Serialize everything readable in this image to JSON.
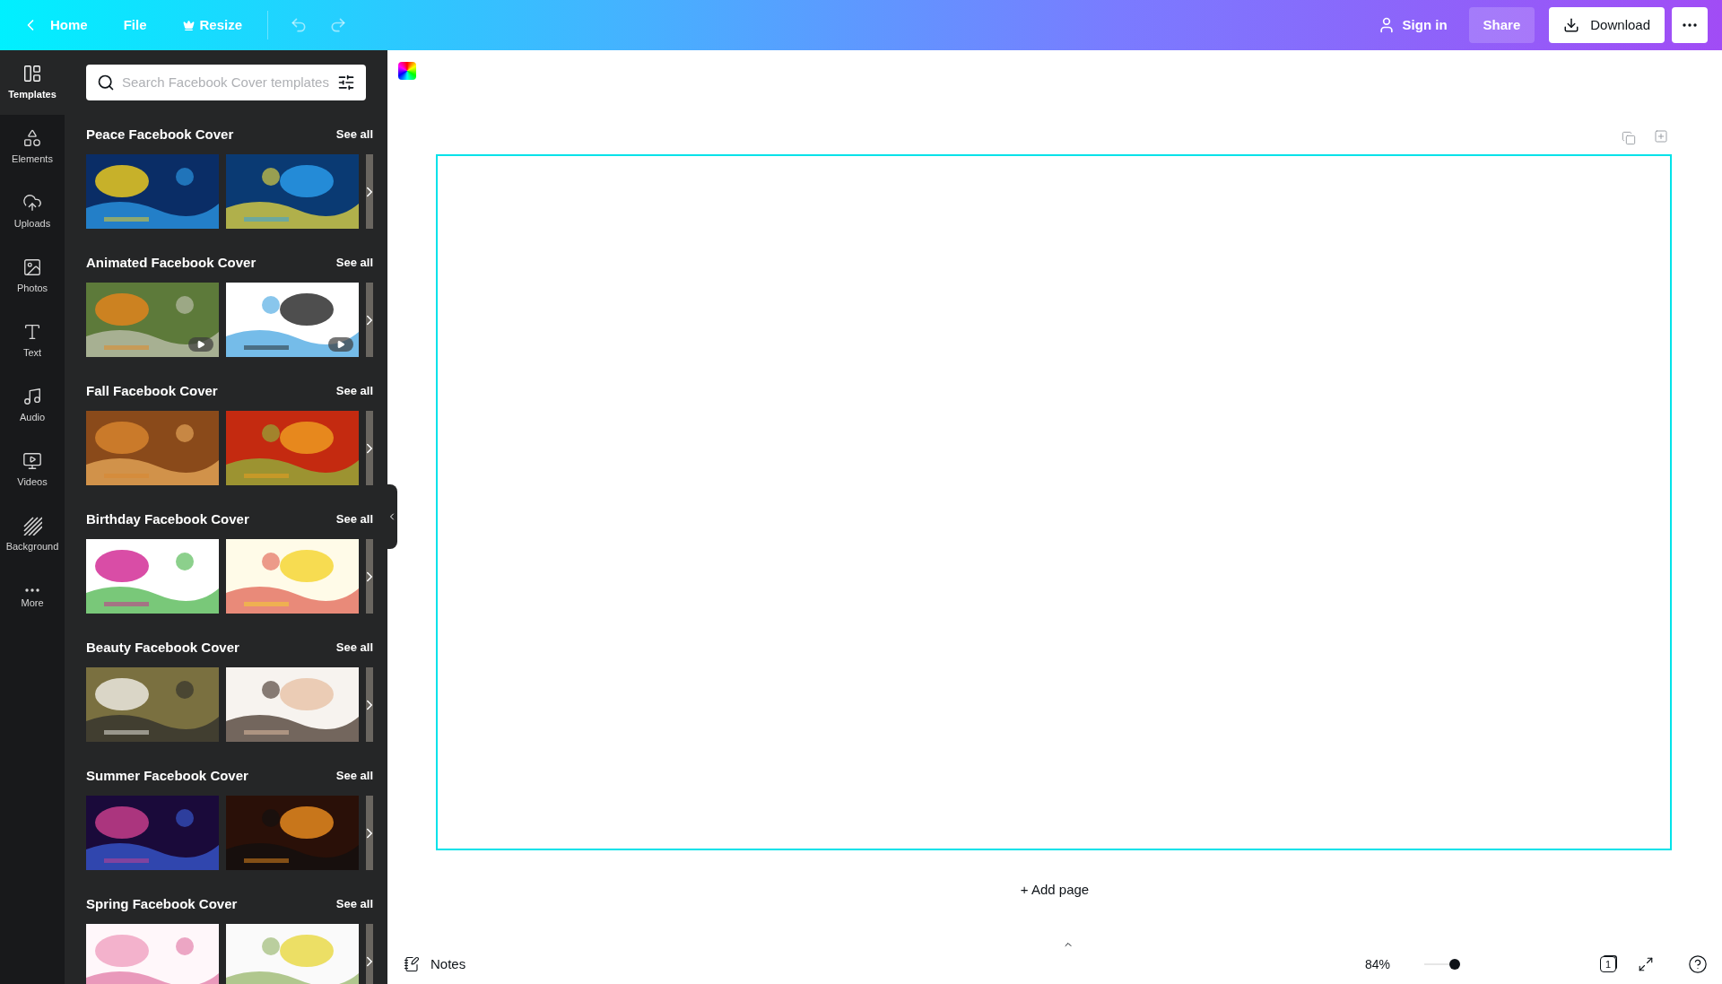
{
  "topbar": {
    "back": "Home",
    "menu": [
      {
        "label": "File",
        "premium": false
      },
      {
        "label": "Resize",
        "premium": true
      }
    ],
    "sign_in": "Sign in",
    "share": "Share",
    "download": "Download"
  },
  "sidebar": {
    "items": [
      {
        "label": "Templates",
        "selected": true
      },
      {
        "label": "Elements",
        "selected": false
      },
      {
        "label": "Uploads",
        "selected": false
      },
      {
        "label": "Photos",
        "selected": false
      },
      {
        "label": "Text",
        "selected": false
      },
      {
        "label": "Audio",
        "selected": false
      },
      {
        "label": "Videos",
        "selected": false
      },
      {
        "label": "Background",
        "selected": false
      },
      {
        "label": "More",
        "selected": false
      }
    ]
  },
  "panel": {
    "search": {
      "placeholder": "Search Facebook Cover templates"
    },
    "sections": [
      {
        "title": "Peace Facebook Cover",
        "see_all": "See all",
        "thumbnails": [
          {
            "video": false
          },
          {
            "video": false
          }
        ]
      },
      {
        "title": "Animated Facebook Cover",
        "see_all": "See all",
        "thumbnails": [
          {
            "video": true
          },
          {
            "video": true
          }
        ]
      },
      {
        "title": "Fall Facebook Cover",
        "see_all": "See all",
        "thumbnails": [
          {
            "video": false
          },
          {
            "video": false
          }
        ]
      },
      {
        "title": "Birthday Facebook Cover",
        "see_all": "See all",
        "thumbnails": [
          {
            "video": false
          },
          {
            "video": false
          }
        ]
      },
      {
        "title": "Beauty Facebook Cover",
        "see_all": "See all",
        "thumbnails": [
          {
            "video": false
          },
          {
            "video": false
          }
        ]
      },
      {
        "title": "Summer Facebook Cover",
        "see_all": "See all",
        "thumbnails": [
          {
            "video": false
          },
          {
            "video": false
          }
        ]
      },
      {
        "title": "Spring Facebook Cover",
        "see_all": "See all",
        "thumbnails": [
          {
            "video": false
          },
          {
            "video": false
          }
        ]
      }
    ]
  },
  "canvas": {
    "add_page": "+ Add page"
  },
  "bottombar": {
    "notes": "Notes",
    "zoom": "84%",
    "zoom_slider": {
      "level": 0.84
    },
    "page_count": "1"
  }
}
